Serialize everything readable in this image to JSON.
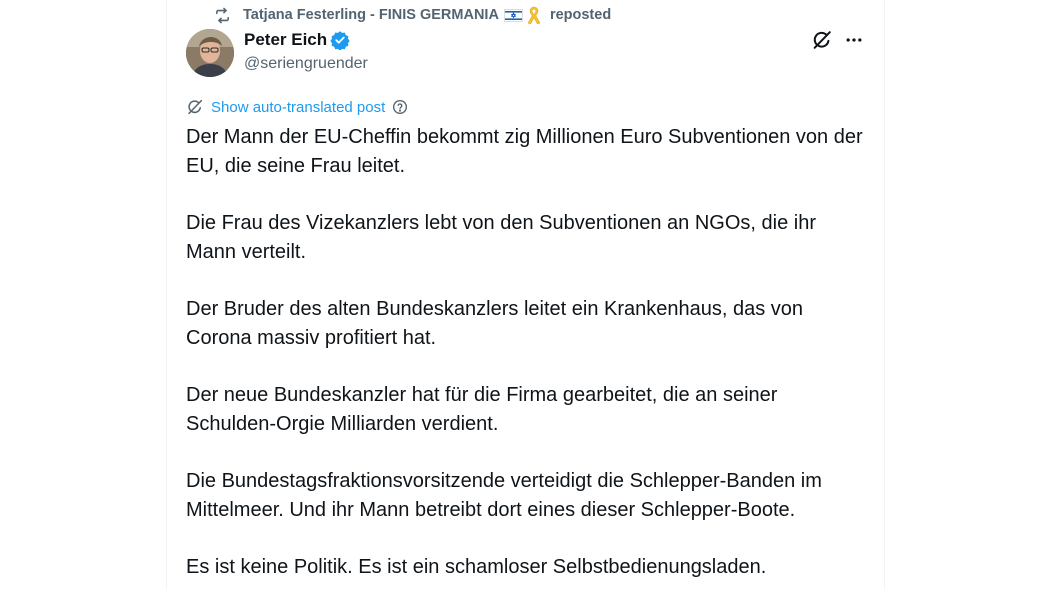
{
  "repost": {
    "reposter_name": "Tatjana Festerling - FINIS GERMANIA",
    "suffix": "reposted",
    "icon": "repost-icon",
    "emoji": [
      "israel-flag-icon",
      "yellow-ribbon-icon"
    ]
  },
  "author": {
    "name": "Peter Eich",
    "handle": "@seriengruender",
    "verified": true,
    "verified_color": "#1d9bf0"
  },
  "actions": {
    "grok_icon": "grok-icon",
    "more_icon": "more-icon"
  },
  "translation": {
    "label": "Show auto-translated post",
    "color": "#1d9bf0"
  },
  "post": {
    "paragraphs": [
      "Der Mann der EU-Cheffin bekommt zig Millionen Euro Subventionen von der EU, die seine Frau leitet.",
      "Die Frau des Vizekanzlers lebt von den Subventionen an NGOs, die ihr Mann verteilt.",
      "Der Bruder des alten Bundeskanzlers leitet ein Krankenhaus, das von Corona massiv profitiert hat.",
      "Der neue Bundeskanzler hat für die Firma gearbeitet, die an seiner Schulden-Orgie Milliarden verdient.",
      "Die Bundestagsfraktionsvorsitzende verteidigt die Schlepper-Banden im Mittelmeer. Und ihr Mann betreibt dort eines dieser Schlepper-Boote.",
      "Es ist keine Politik. Es ist ein schamloser Selbstbedienungsladen."
    ]
  }
}
